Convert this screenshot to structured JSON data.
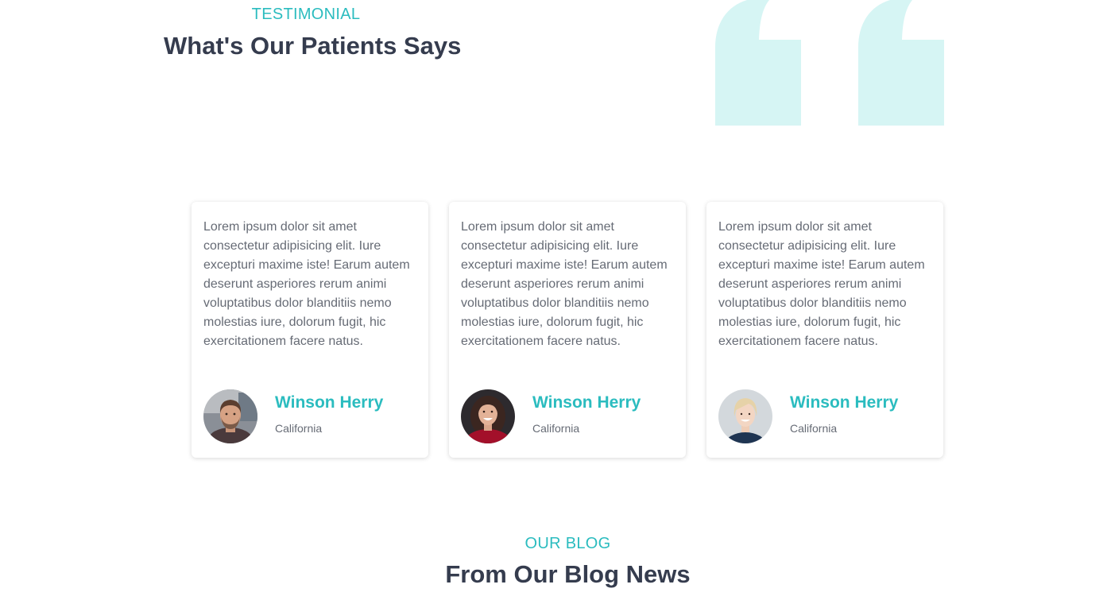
{
  "colors": {
    "accent": "#2bbcbf",
    "heading": "#353c4e",
    "quote": "#d6f5f4"
  },
  "testimonial_section": {
    "eyebrow": "TESTIMONIAL",
    "title": "What's Our Patients Says",
    "decor_icon": "quote-mark-icon"
  },
  "testimonials": [
    {
      "text": "Lorem ipsum dolor sit amet consectetur adipisicing elit. Iure excepturi maxime iste! Earum autem deserunt asperiores rerum animi voluptatibus dolor blanditiis nemo molestias iure, dolorum fugit, hic exercitationem facere natus.",
      "name": "Winson Herry",
      "location": "California",
      "avatar": "bearded-man-avatar"
    },
    {
      "text": "Lorem ipsum dolor sit amet consectetur adipisicing elit. Iure excepturi maxime iste! Earum autem deserunt asperiores rerum animi voluptatibus dolor blanditiis nemo molestias iure, dolorum fugit, hic exercitationem facere natus.",
      "name": "Winson Herry",
      "location": "California",
      "avatar": "smiling-woman-avatar"
    },
    {
      "text": "Lorem ipsum dolor sit amet consectetur adipisicing elit. Iure excepturi maxime iste! Earum autem deserunt asperiores rerum animi voluptatibus dolor blanditiis nemo molestias iure, dolorum fugit, hic exercitationem facere natus.",
      "name": "Winson Herry",
      "location": "California",
      "avatar": "blonde-woman-avatar"
    }
  ],
  "blog_section": {
    "eyebrow": "OUR BLOG",
    "title": "From Our Blog News"
  }
}
